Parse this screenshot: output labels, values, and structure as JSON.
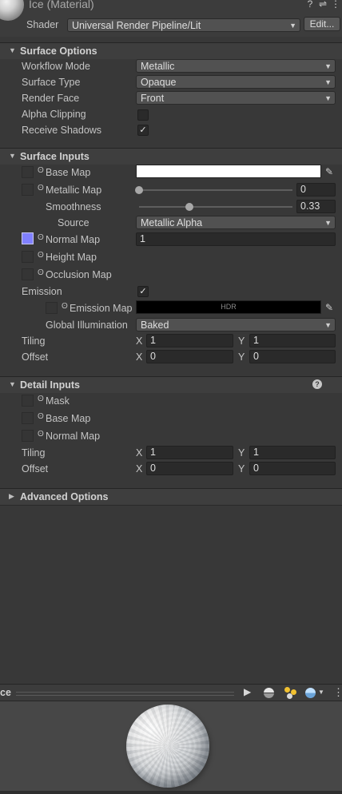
{
  "header": {
    "title": "Ice (Material)",
    "shader_label": "Shader",
    "shader_value": "Universal Render Pipeline/Lit",
    "edit_button": "Edit...",
    "help_icon": "help-icon",
    "settings_icon": "settings-icon",
    "more_icon": "more-icon"
  },
  "surface_options": {
    "title": "Surface Options",
    "workflow_mode": {
      "label": "Workflow Mode",
      "value": "Metallic"
    },
    "surface_type": {
      "label": "Surface Type",
      "value": "Opaque"
    },
    "render_face": {
      "label": "Render Face",
      "value": "Front"
    },
    "alpha_clipping": {
      "label": "Alpha Clipping",
      "checked": false
    },
    "receive_shadows": {
      "label": "Receive Shadows",
      "checked": true
    }
  },
  "surface_inputs": {
    "title": "Surface Inputs",
    "base_map": {
      "label": "Base Map",
      "color": "#ffffff"
    },
    "metallic_map": {
      "label": "Metallic Map",
      "value": "0"
    },
    "smoothness": {
      "label": "Smoothness",
      "value": "0.33"
    },
    "source": {
      "label": "Source",
      "value": "Metallic Alpha"
    },
    "normal_map": {
      "label": "Normal Map",
      "value": "1",
      "color": "#8080ff"
    },
    "height_map": {
      "label": "Height Map"
    },
    "occlusion_map": {
      "label": "Occlusion Map"
    },
    "emission": {
      "label": "Emission",
      "checked": true
    },
    "emission_map": {
      "label": "Emission Map",
      "hdr": "HDR",
      "color": "#000000"
    },
    "global_illumination": {
      "label": "Global Illumination",
      "value": "Baked"
    },
    "tiling": {
      "label": "Tiling",
      "x_label": "X",
      "x": "1",
      "y_label": "Y",
      "y": "1"
    },
    "offset": {
      "label": "Offset",
      "x_label": "X",
      "x": "0",
      "y_label": "Y",
      "y": "0"
    }
  },
  "detail_inputs": {
    "title": "Detail Inputs",
    "mask": {
      "label": "Mask"
    },
    "base_map": {
      "label": "Base Map"
    },
    "normal_map": {
      "label": "Normal Map"
    },
    "tiling": {
      "label": "Tiling",
      "x_label": "X",
      "x": "1",
      "y_label": "Y",
      "y": "1"
    },
    "offset": {
      "label": "Offset",
      "x_label": "X",
      "x": "0",
      "y_label": "Y",
      "y": "0"
    }
  },
  "advanced_options": {
    "title": "Advanced Options"
  },
  "preview": {
    "title_fragment": "ce"
  },
  "colors": {
    "panel": "#383838",
    "normal_swatch": "#8080ff"
  }
}
